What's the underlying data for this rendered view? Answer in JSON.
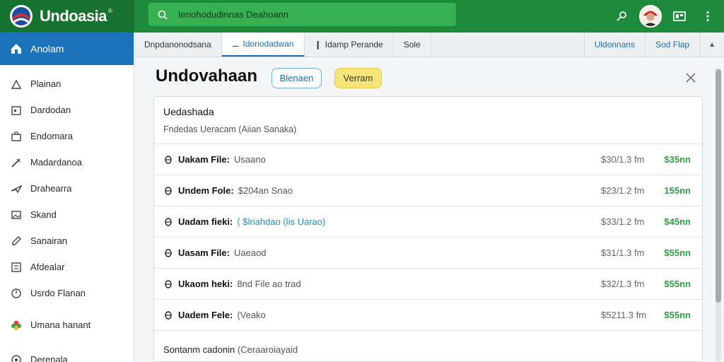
{
  "app": {
    "name": "Undoasia",
    "reg": "®"
  },
  "search": {
    "placeholder": "Ienohodudinnas Deahoann"
  },
  "sidebar": {
    "active": {
      "label": "Anolam",
      "icon": "home-icon"
    },
    "items": [
      {
        "label": "Plainan",
        "icon": "upload-icon"
      },
      {
        "label": "Dardodan",
        "icon": "calendar-icon"
      },
      {
        "label": "Endomara",
        "icon": "briefcase-icon"
      },
      {
        "label": "Madardanoa",
        "icon": "pen-icon"
      },
      {
        "label": "Drahearra",
        "icon": "plane-icon"
      },
      {
        "label": "Skand",
        "icon": "image-icon"
      },
      {
        "label": "Sanairan",
        "icon": "pencil-icon"
      },
      {
        "label": "Afdealar",
        "icon": "list-icon"
      },
      {
        "label": "Usrdo Flanan",
        "icon": "clock-icon"
      },
      {
        "label": "Umana hanant",
        "icon": "flower-icon"
      },
      {
        "label": "Derenala",
        "icon": "settings-icon"
      }
    ]
  },
  "tabs": [
    {
      "label": "Dnpdanonodsana",
      "active": false
    },
    {
      "label": "Idonodadwan",
      "active": true
    },
    {
      "label": "Idamp Perande",
      "active": false
    },
    {
      "label": "Sole",
      "active": false
    }
  ],
  "tab_links": [
    "Uldonnans",
    "Sod Flap"
  ],
  "page": {
    "title": "Undovahaan",
    "pill_outline": "Blenaen",
    "pill_yellow": "Verram"
  },
  "card": {
    "title": "Uedashada",
    "subtitle": "Fndedas Ueracam (Aiian Sanaka)",
    "rows": [
      {
        "label": "Uakam File:",
        "detail": "Usaano",
        "link": false,
        "size": "$30/1.3 fm",
        "price": "$35nn"
      },
      {
        "label": "Undem Fole:",
        "detail": "$204an Snao",
        "link": false,
        "size": "$23/1.2 fm",
        "price": "155nn"
      },
      {
        "label": "Uadam fieki:",
        "detail": "( $lriahdao (lis Uarao)",
        "link": true,
        "size": "$33/1.2 fm",
        "price": "$45nn"
      },
      {
        "label": "Uasam File:",
        "detail": "Uaeaod",
        "link": false,
        "size": "$31/1.3 fm",
        "price": "$55nn"
      },
      {
        "label": "Ukaom heki:",
        "detail": "8nd File ao trad",
        "link": false,
        "size": "$32/1.3 fm",
        "price": "$55nn"
      },
      {
        "label": "Uadem Fele:",
        "detail": "(Veako",
        "link": false,
        "size": "$5211.3 fm",
        "price": "$55nn"
      }
    ],
    "footer_label": "Sontanm cadonin",
    "footer_muted": "(Ceraaroiayaid"
  },
  "colors": {
    "topbar": "#1e8a3c",
    "sidebar_active": "#1d73b9",
    "price_green": "#2da043",
    "link_blue": "#1e8fc8"
  }
}
